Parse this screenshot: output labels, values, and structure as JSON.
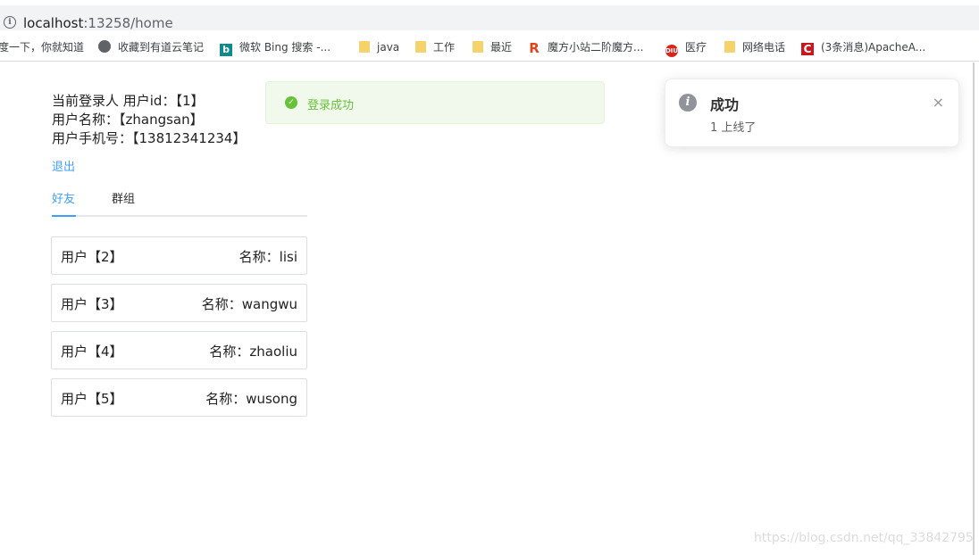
{
  "browser": {
    "url_host": "localhost",
    "url_rest": ":13258/home",
    "bookmarks": [
      {
        "label": "度一下，你就知道",
        "icon": "baidu-icon"
      },
      {
        "label": "收藏到有道云笔记",
        "icon": "globe-icon"
      },
      {
        "label": "微软 Bing 搜索 -...",
        "icon": "bing-icon"
      },
      {
        "label": "java",
        "icon": "folder-icon"
      },
      {
        "label": "工作",
        "icon": "folder-icon"
      },
      {
        "label": "最近",
        "icon": "folder-icon"
      },
      {
        "label": "魔方小站二阶魔方...",
        "icon": "r-logo-icon"
      },
      {
        "label": "医疗",
        "icon": "diu-logo-icon"
      },
      {
        "label": "网络电话",
        "icon": "folder-icon"
      },
      {
        "label": "(3条消息)ApacheA...",
        "icon": "csdn-icon"
      }
    ]
  },
  "user": {
    "line1": "当前登录人 用户id：【1】",
    "line2": "用户名称：【zhangsan】",
    "line3": "用户手机号：【13812341234】",
    "logout_label": "退出"
  },
  "tabs": [
    {
      "label": "好友",
      "active": true
    },
    {
      "label": "群组",
      "active": false
    }
  ],
  "friends": [
    {
      "id_text": "用户【2】",
      "name_text": "名称：lisi"
    },
    {
      "id_text": "用户【3】",
      "name_text": "名称：wangwu"
    },
    {
      "id_text": "用户【4】",
      "name_text": "名称：zhaoliu"
    },
    {
      "id_text": "用户【5】",
      "name_text": "名称：wusong"
    }
  ],
  "message": {
    "text": "登录成功",
    "type": "success"
  },
  "notification": {
    "title": "成功",
    "content": "1 上线了",
    "close_glyph": "×"
  },
  "watermark": "https://blog.csdn.net/qq_33842795",
  "colors": {
    "primary": "#409eff",
    "success": "#67c23a",
    "info": "#909399"
  }
}
